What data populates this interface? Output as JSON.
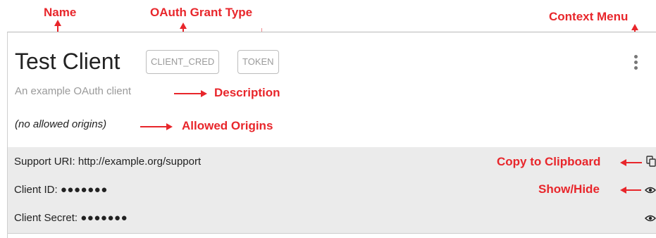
{
  "annotations": {
    "name": "Name",
    "grant_type": "OAuth Grant Type",
    "context_menu": "Context Menu",
    "description": "Description",
    "allowed_origins": "Allowed Origins",
    "copy": "Copy to Clipboard",
    "show_hide": "Show/Hide"
  },
  "client": {
    "name": "Test Client",
    "badges": [
      "CLIENT_CRED",
      "TOKEN"
    ],
    "description": "An example OAuth client",
    "allowed_origins": "(no allowed origins)"
  },
  "details": {
    "support_uri": "Support URI: http://example.org/support",
    "client_id_label": "Client ID:",
    "client_id_mask": "●●●●●●●",
    "client_secret_label": "Client Secret:",
    "client_secret_mask": "●●●●●●●"
  },
  "icons": {
    "menu": "kebab-menu-icon",
    "copy": "copy-icon",
    "show": "eye-icon"
  },
  "colors": {
    "annotation": "#e8262b",
    "rows_bg": "#ebebeb",
    "badge_border": "#bdbdbd"
  }
}
